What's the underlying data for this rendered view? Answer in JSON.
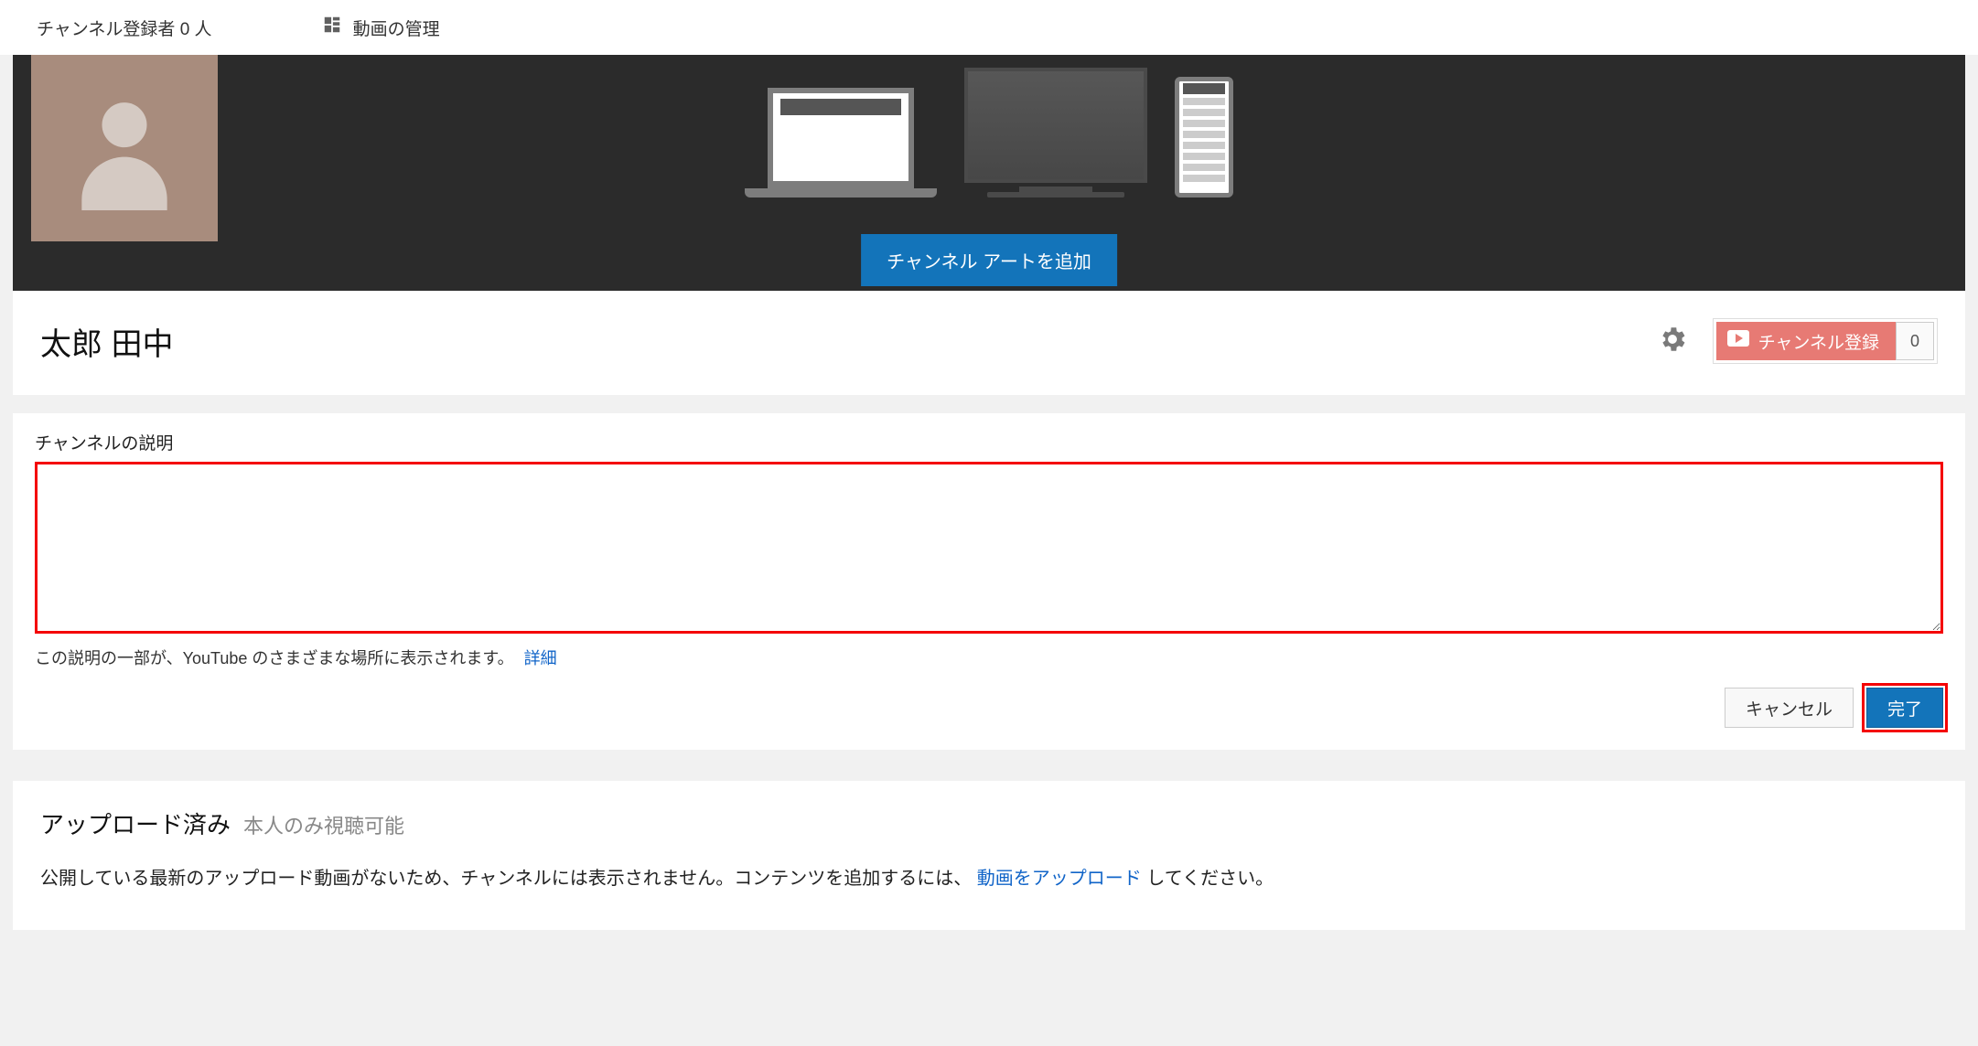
{
  "topbar": {
    "subscribers_label": "チャンネル登録者 0 人",
    "manage_videos_label": "動画の管理"
  },
  "banner": {
    "add_art_label": "チャンネル アートを追加"
  },
  "channel": {
    "name": "太郎 田中",
    "subscribe_label": "チャンネル登録",
    "subscribe_count": "0"
  },
  "description": {
    "section_label": "チャンネルの説明",
    "value": "",
    "help_text": "この説明の一部が、YouTube のさまざまな場所に表示されます。",
    "details_link": "詳細",
    "cancel_label": "キャンセル",
    "done_label": "完了"
  },
  "uploads": {
    "title": "アップロード済み",
    "visibility": "本人のみ視聴可能",
    "message_prefix": "公開している最新のアップロード動画がないため、チャンネルには表示されません。コンテンツを追加するには、",
    "upload_link": "動画をアップロード",
    "message_suffix": "してください。"
  }
}
